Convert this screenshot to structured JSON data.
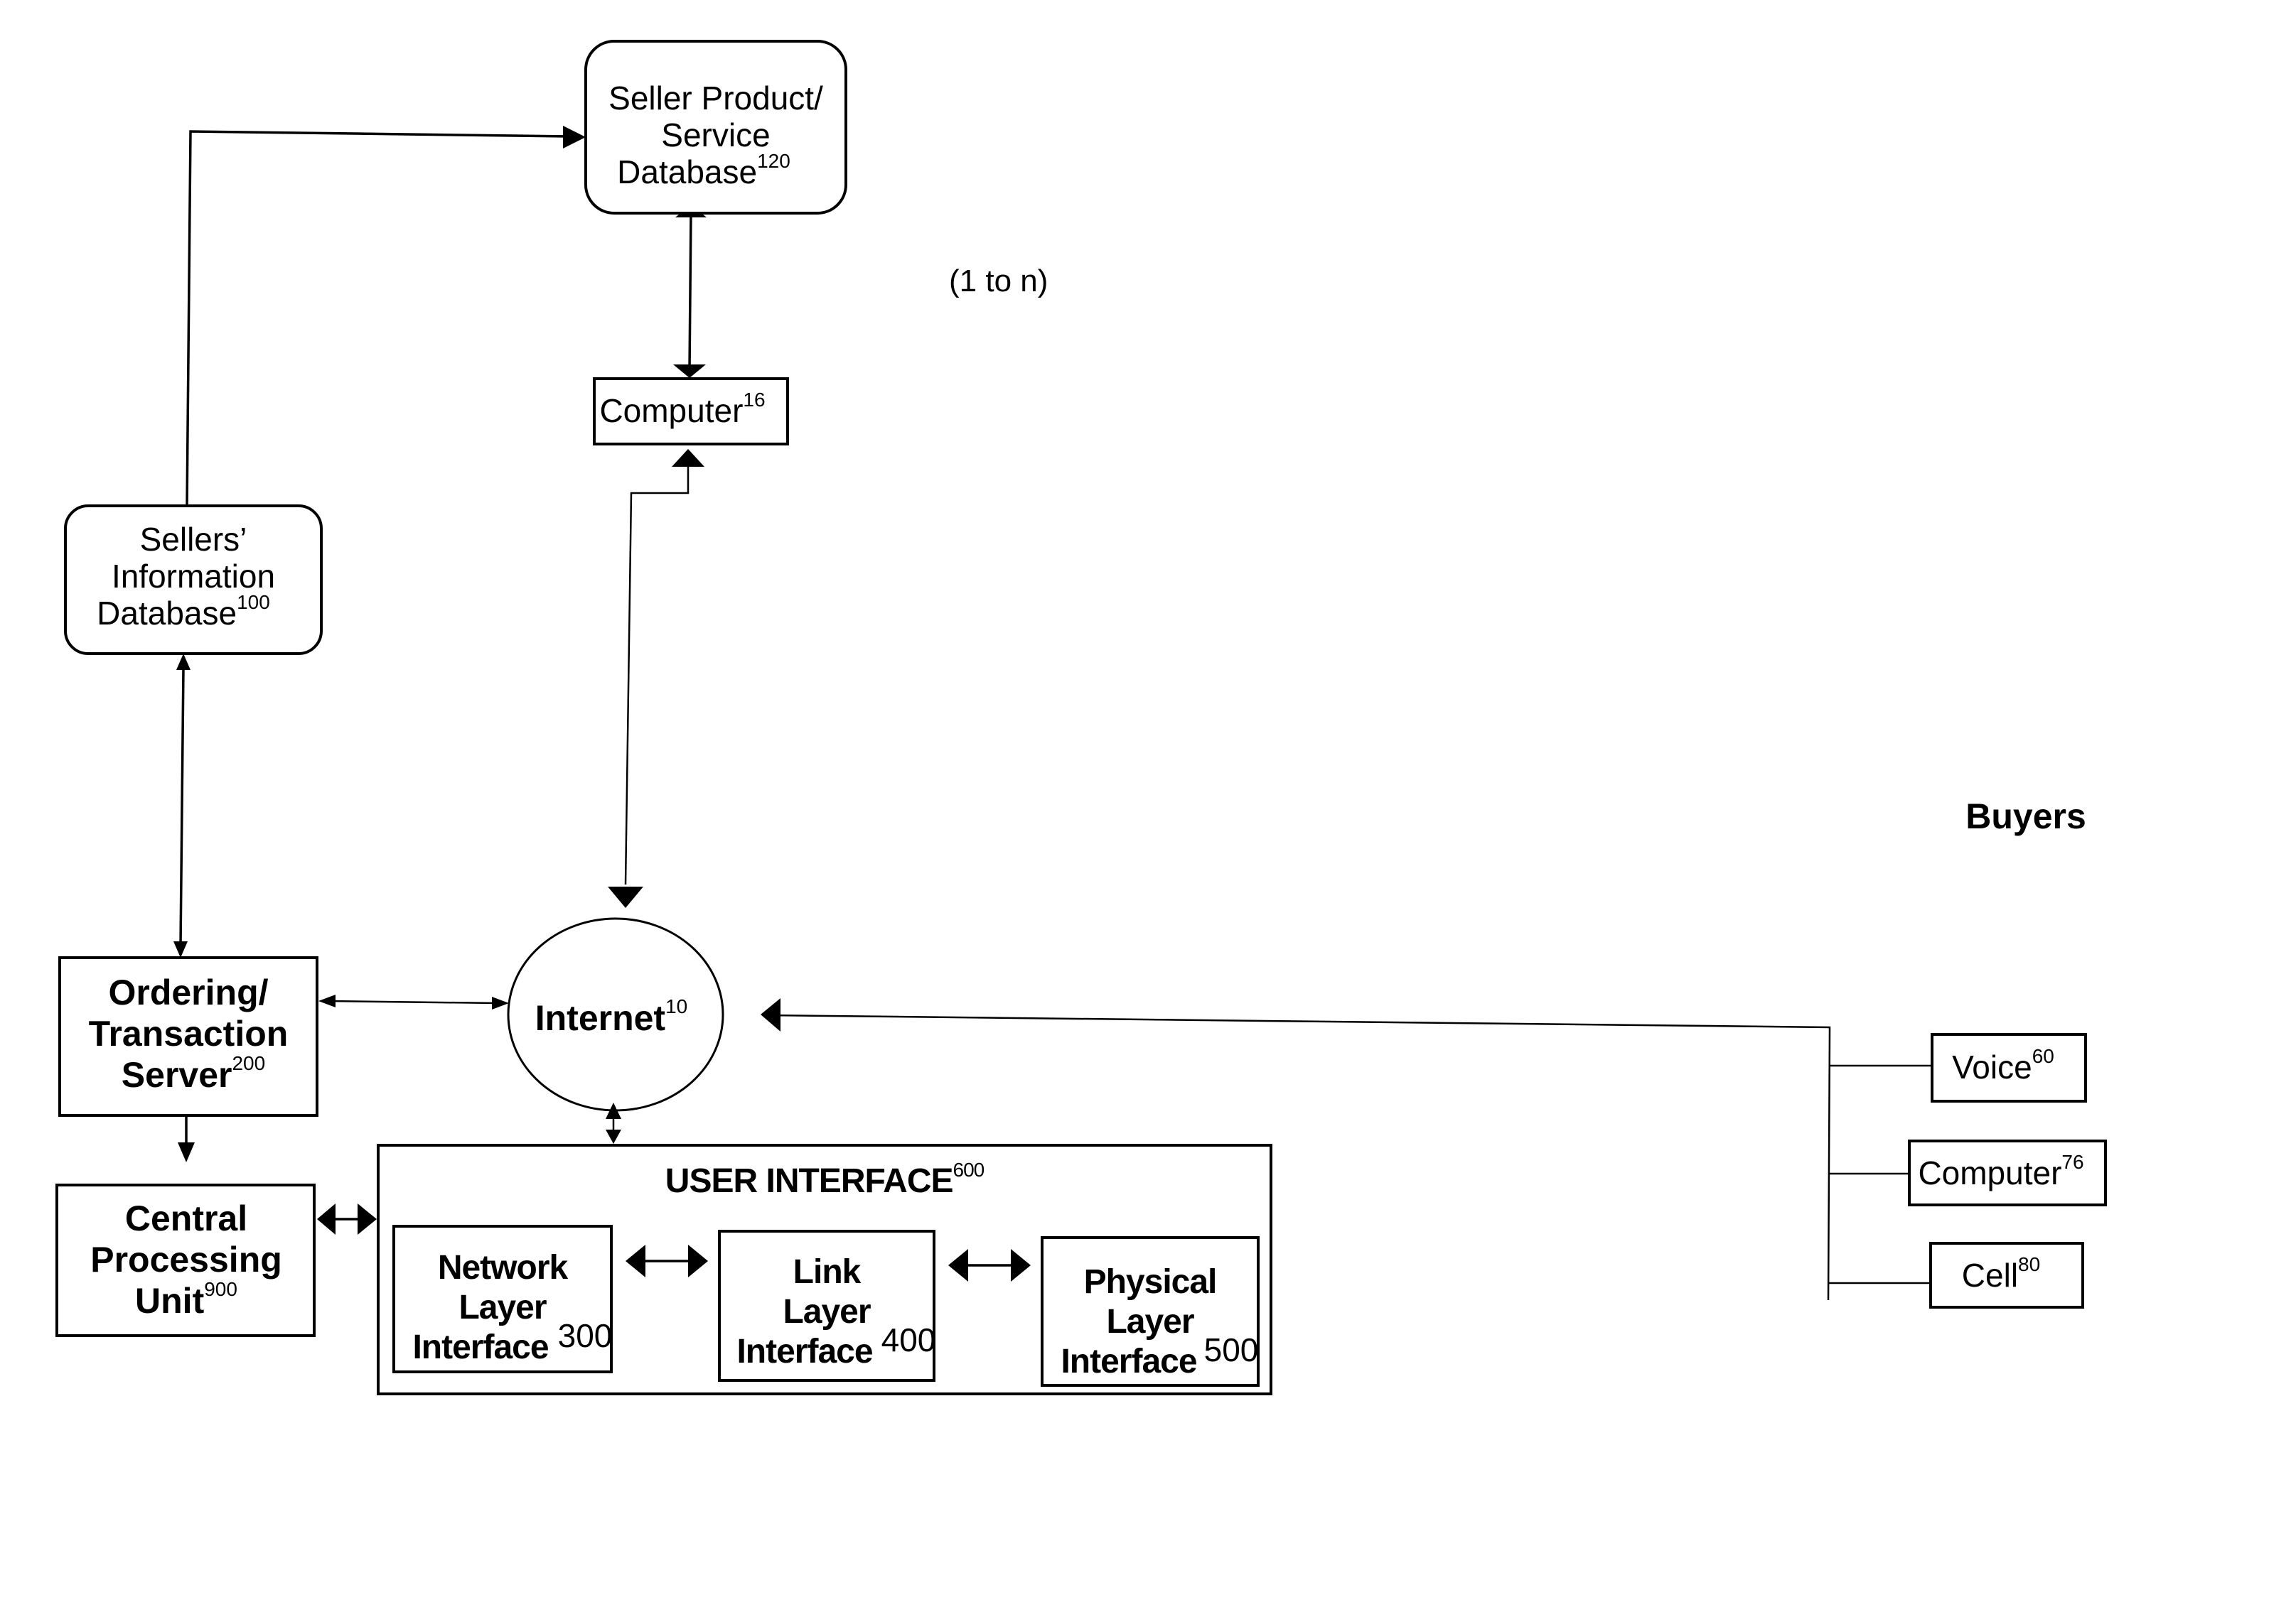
{
  "diagram": {
    "nodes": {
      "seller_product_db": {
        "lines": [
          "Seller Product/",
          "Service",
          "Database"
        ],
        "ref": "120"
      },
      "computer_16": {
        "label": "Computer",
        "ref": "16"
      },
      "multiplicity_note": "(1 to n)",
      "sellers_info_db": {
        "lines": [
          "Sellers’",
          "Information",
          "Database"
        ],
        "ref": "100"
      },
      "ordering_server": {
        "lines": [
          "Ordering/",
          "Transaction",
          "Server"
        ],
        "ref": "200"
      },
      "internet": {
        "label": "Internet",
        "ref": "10"
      },
      "cpu": {
        "lines": [
          "Central",
          "Processing",
          "Unit"
        ],
        "ref": "900"
      },
      "user_interface": {
        "label": "USER INTERFACE",
        "ref": "600"
      },
      "network_layer": {
        "lines": [
          "Network",
          "Layer",
          "Interface"
        ],
        "ref": "300"
      },
      "link_layer": {
        "lines": [
          "Link",
          "Layer",
          "Interface"
        ],
        "ref": "400"
      },
      "physical_layer": {
        "lines": [
          "Physical",
          "Layer",
          "Interface"
        ],
        "ref": "500"
      },
      "buyers_heading": "Buyers",
      "voice": {
        "label": "Voice",
        "ref": "60"
      },
      "computer_76": {
        "label": "Computer",
        "ref": "76"
      },
      "cell": {
        "label": "Cell",
        "ref": "80"
      }
    },
    "connections": [
      {
        "from": "sellers_info_db",
        "to": "seller_product_db",
        "direction": "one-way"
      },
      {
        "from": "seller_product_db",
        "to": "computer_16",
        "direction": "two-way"
      },
      {
        "from": "computer_16",
        "to": "internet",
        "direction": "two-way"
      },
      {
        "from": "sellers_info_db",
        "to": "ordering_server",
        "direction": "two-way"
      },
      {
        "from": "ordering_server",
        "to": "internet",
        "direction": "two-way"
      },
      {
        "from": "ordering_server",
        "to": "cpu",
        "direction": "two-way"
      },
      {
        "from": "cpu",
        "to": "user_interface",
        "direction": "two-way"
      },
      {
        "from": "internet",
        "to": "user_interface",
        "direction": "two-way"
      },
      {
        "from": "network_layer",
        "to": "link_layer",
        "direction": "two-way"
      },
      {
        "from": "link_layer",
        "to": "physical_layer",
        "direction": "two-way"
      },
      {
        "from": "buyers",
        "to": "internet",
        "direction": "one-way"
      }
    ]
  }
}
